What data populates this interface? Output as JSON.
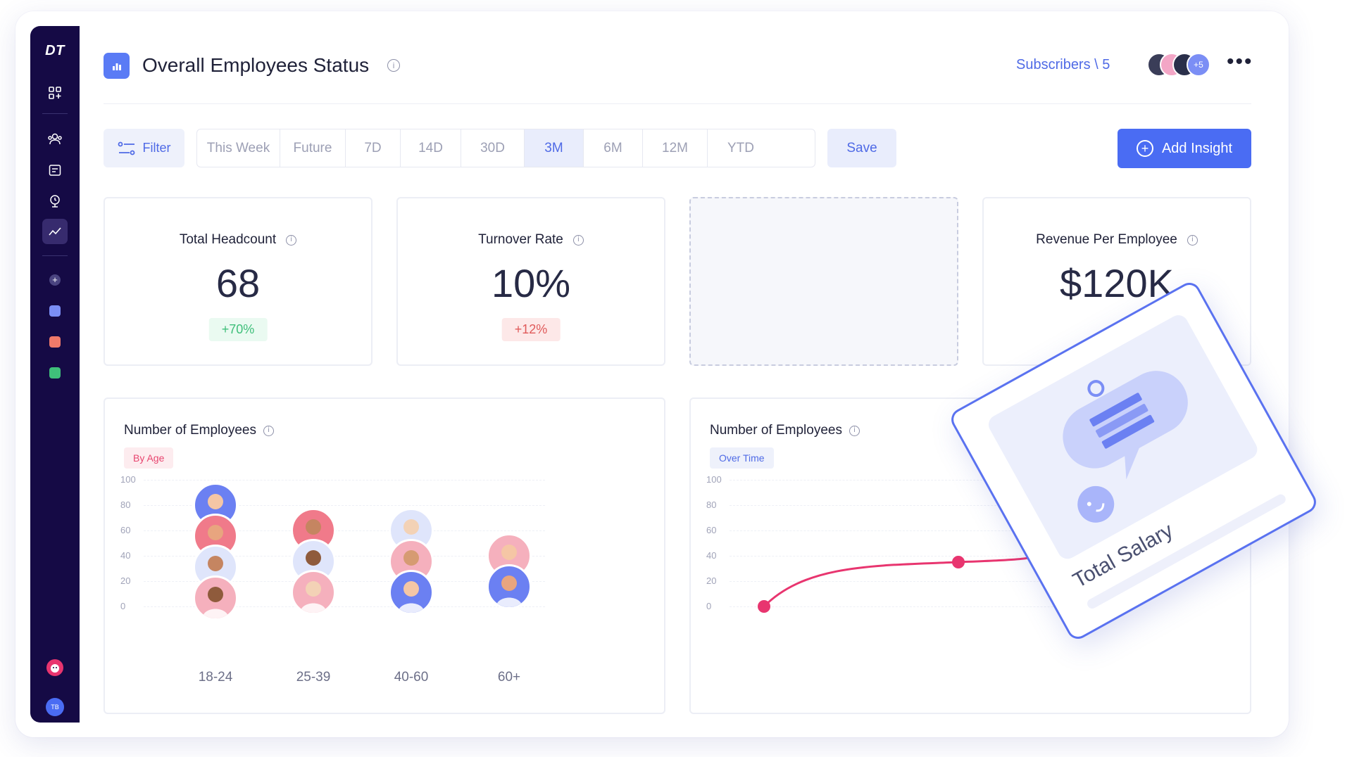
{
  "sidebar": {
    "logo": "DT",
    "user_initials": "TB",
    "icons": [
      "dashboard-icon",
      "team-icon",
      "tasks-icon",
      "presentation-icon",
      "analytics-icon",
      "add-circle-icon",
      "blue-app-icon",
      "red-app-icon",
      "green-app-icon",
      "support-icon"
    ]
  },
  "header": {
    "title": "Overall Employees Status",
    "subscribers_label": "Subscribers \\ 5",
    "avatars_more": "+5"
  },
  "toolbar": {
    "filter_label": "Filter",
    "ranges": [
      "This Week",
      "Future",
      "7D",
      "14D",
      "30D",
      "3M",
      "6M",
      "12M",
      "YTD"
    ],
    "active_range": "3M",
    "save_label": "Save",
    "add_insight_label": "Add Insight"
  },
  "kpis": {
    "headcount": {
      "label": "Total Headcount",
      "value": "68",
      "delta": "+70%"
    },
    "turnover": {
      "label": "Turnover Rate",
      "value": "10%",
      "delta": "+12%"
    },
    "revenue": {
      "label": "Revenue Per Employee",
      "value": "$120K"
    }
  },
  "age_chart": {
    "title": "Number of Employees",
    "tag": "By Age"
  },
  "time_chart": {
    "title": "Number of Employees",
    "tag": "Over Time"
  },
  "floating_card": {
    "label": "Total Salary"
  },
  "colors": {
    "sidebar": "#150a45",
    "accent": "#4a6cf3",
    "line": "#e8356f",
    "positive": "#3fbf7a",
    "negative": "#e05a5a"
  },
  "chart_data": [
    {
      "type": "scatter",
      "title": "Number of Employees",
      "subtitle": "By Age",
      "categories": [
        "18-24",
        "25-39",
        "40-60",
        "60+"
      ],
      "values": [
        80,
        60,
        60,
        40
      ],
      "y_ticks": [
        "100",
        "80",
        "60",
        "40",
        "20",
        "0"
      ],
      "ylim": [
        0,
        100
      ],
      "grid": true
    },
    {
      "type": "line",
      "title": "Number of Employees",
      "subtitle": "Over Time",
      "y_ticks": [
        "100",
        "80",
        "60",
        "40",
        "20",
        "0"
      ],
      "ylim": [
        0,
        100
      ],
      "series": [
        {
          "values": [
            0,
            35
          ]
        }
      ],
      "grid": true
    }
  ]
}
